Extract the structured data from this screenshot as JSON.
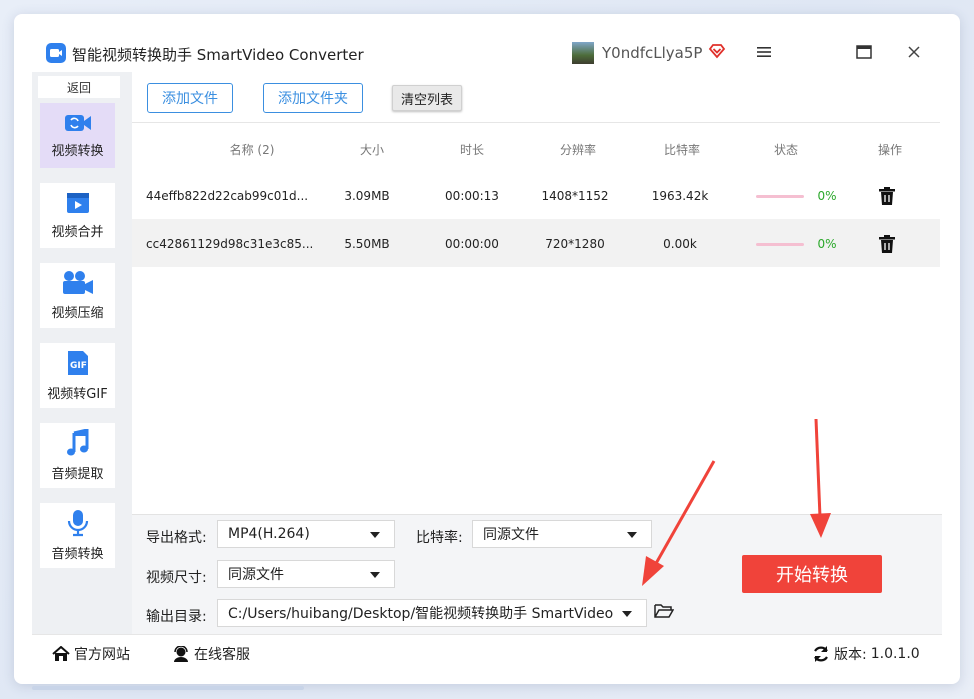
{
  "app": {
    "title": "智能视频转换助手 SmartVideo Converter",
    "user_name": "Y0ndfcLlya5P"
  },
  "sidebar": {
    "back_label": "返回",
    "items": [
      {
        "label": "视频转换",
        "icon": "video-convert-icon",
        "active": true
      },
      {
        "label": "视频合并",
        "icon": "video-merge-icon",
        "active": false
      },
      {
        "label": "视频压缩",
        "icon": "video-compress-icon",
        "active": false
      },
      {
        "label": "视频转GIF",
        "icon": "gif-icon",
        "active": false
      },
      {
        "label": "音频提取",
        "icon": "music-note-icon",
        "active": false
      },
      {
        "label": "音频转换",
        "icon": "microphone-icon",
        "active": false
      }
    ]
  },
  "toolbar": {
    "add_file": "添加文件",
    "add_folder": "添加文件夹",
    "clear_list": "清空列表"
  },
  "table": {
    "headers": {
      "name": "名称 (2)",
      "size": "大小",
      "duration": "时长",
      "resolution": "分辨率",
      "bitrate": "比特率",
      "status": "状态",
      "action": "操作"
    },
    "rows": [
      {
        "name": "44effb822d22cab99c01d...",
        "size": "3.09MB",
        "duration": "00:00:13",
        "resolution": "1408*1152",
        "bitrate": "1963.42k",
        "progress": "0%"
      },
      {
        "name": "cc42861129d98c31e3c85...",
        "size": "5.50MB",
        "duration": "00:00:00",
        "resolution": "720*1280",
        "bitrate": "0.00k",
        "progress": "0%"
      }
    ]
  },
  "settings": {
    "format_label": "导出格式:",
    "format_value": "MP4(H.264)",
    "bitrate_label": "比特率:",
    "bitrate_value": "同源文件",
    "size_label": "视频尺寸:",
    "size_value": "同源文件",
    "output_label": "输出目录:",
    "output_value": "C:/Users/huibang/Desktop/智能视频转换助手 SmartVideo",
    "start_button": "开始转换"
  },
  "footer": {
    "website": "官方网站",
    "support": "在线客服",
    "version_label": "版本:",
    "version": "1.0.1.0"
  },
  "colors": {
    "accent": "#3b8fe0",
    "start": "#f0433a",
    "active_nav": "#e4dcf7",
    "annotation_arrow": "#f0433a"
  }
}
